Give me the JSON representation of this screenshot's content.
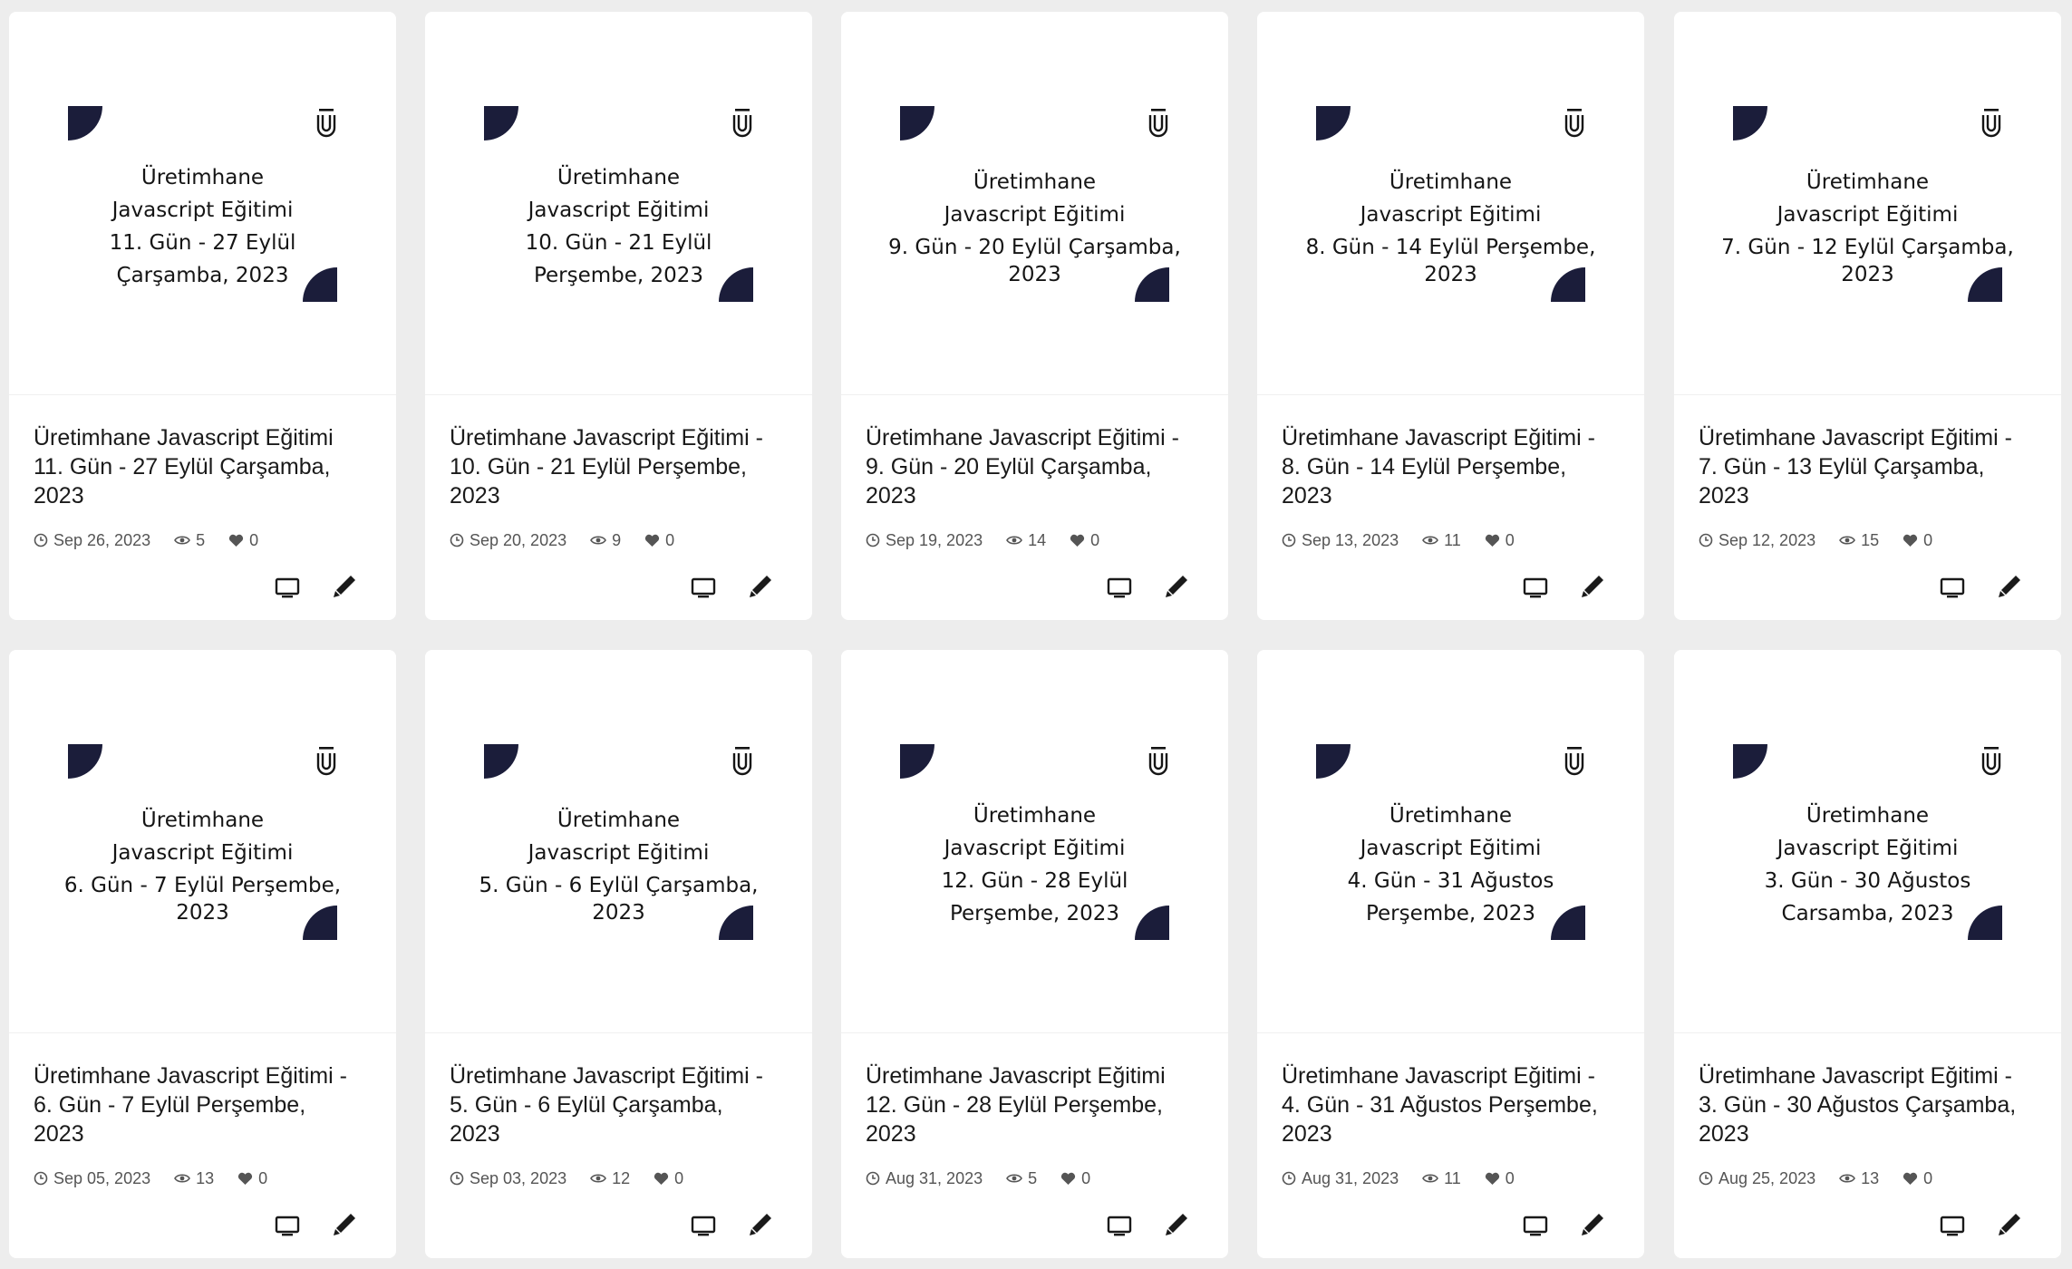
{
  "cards": [
    {
      "thumb_l1": "Üretimhane",
      "thumb_l2": "Javascript Eğitimi",
      "thumb_l3": "11. Gün - 27 Eylül",
      "thumb_l4": "Çarşamba, 2023",
      "title": "Üretimhane Javascript Eğitimi\n11. Gün - 27 Eylül Çarşamba,\n2023",
      "date": "Sep 26, 2023",
      "views": "5",
      "likes": "0"
    },
    {
      "thumb_l1": "Üretimhane",
      "thumb_l2": "Javascript Eğitimi",
      "thumb_l3": "10. Gün - 21 Eylül",
      "thumb_l4": "Perşembe, 2023",
      "title": "Üretimhane Javascript Eğitimi -\n10. Gün - 21 Eylül Perşembe,\n2023",
      "date": "Sep 20, 2023",
      "views": "9",
      "likes": "0"
    },
    {
      "thumb_l1": "Üretimhane",
      "thumb_l2": "Javascript Eğitimi",
      "thumb_l3": "9. Gün - 20 Eylül Çarşamba,",
      "thumb_l4": "2023",
      "title": "Üretimhane Javascript Eğitimi -\n9. Gün - 20 Eylül Çarşamba,\n2023",
      "date": "Sep 19, 2023",
      "views": "14",
      "likes": "0"
    },
    {
      "thumb_l1": "Üretimhane",
      "thumb_l2": "Javascript Eğitimi",
      "thumb_l3": "8. Gün - 14 Eylül Perşembe,",
      "thumb_l4": "2023",
      "title": "Üretimhane Javascript Eğitimi -\n8. Gün - 14 Eylül Perşembe,\n2023",
      "date": "Sep 13, 2023",
      "views": "11",
      "likes": "0"
    },
    {
      "thumb_l1": "Üretimhane",
      "thumb_l2": "Javascript Eğitimi",
      "thumb_l3": "7. Gün - 12 Eylül Çarşamba,",
      "thumb_l4": "2023",
      "title": "Üretimhane Javascript Eğitimi -\n7. Gün - 13 Eylül Çarşamba,\n2023",
      "date": "Sep 12, 2023",
      "views": "15",
      "likes": "0"
    },
    {
      "thumb_l1": "Üretimhane",
      "thumb_l2": "Javascript Eğitimi",
      "thumb_l3": "6. Gün - 7 Eylül Perşembe,",
      "thumb_l4": "2023",
      "title": "Üretimhane Javascript Eğitimi -\n6. Gün - 7 Eylül Perşembe,\n2023",
      "date": "Sep 05, 2023",
      "views": "13",
      "likes": "0"
    },
    {
      "thumb_l1": "Üretimhane",
      "thumb_l2": "Javascript Eğitimi",
      "thumb_l3": "5. Gün - 6 Eylül Çarşamba,",
      "thumb_l4": "2023",
      "title": "Üretimhane Javascript Eğitimi -\n5. Gün - 6 Eylül Çarşamba,\n2023",
      "date": "Sep 03, 2023",
      "views": "12",
      "likes": "0"
    },
    {
      "thumb_l1": "Üretimhane",
      "thumb_l2": "Javascript Eğitimi",
      "thumb_l3": "12. Gün - 28 Eylül",
      "thumb_l4": "Perşembe, 2023",
      "title": "Üretimhane Javascript Eğitimi\n12. Gün - 28 Eylül Perşembe,\n2023",
      "date": "Aug 31, 2023",
      "views": "5",
      "likes": "0"
    },
    {
      "thumb_l1": "Üretimhane",
      "thumb_l2": "Javascript Eğitimi",
      "thumb_l3": "4. Gün - 31 Ağustos",
      "thumb_l4": "Perşembe, 2023",
      "title": "Üretimhane Javascript Eğitimi -\n4. Gün - 31 Ağustos Perşembe,\n2023",
      "date": "Aug 31, 2023",
      "views": "11",
      "likes": "0"
    },
    {
      "thumb_l1": "Üretimhane",
      "thumb_l2": "Javascript Eğitimi",
      "thumb_l3": "3. Gün - 30 Ağustos",
      "thumb_l4": "Carsamba, 2023",
      "title": "Üretimhane Javascript Eğitimi -\n3. Gün - 30 Ağustos Çarşamba,\n2023",
      "date": "Aug 25, 2023",
      "views": "13",
      "likes": "0"
    }
  ],
  "icons": {
    "date": "clock-icon",
    "views": "eye-icon",
    "likes": "heart-icon",
    "present": "monitor-icon",
    "edit": "pen-icon",
    "logo": "u-logo-icon"
  },
  "colors": {
    "page_bg": "#ededed",
    "card_bg": "#ffffff",
    "accent_navy": "#1b1d3a",
    "text": "#1a1a1a",
    "meta_text": "#555555"
  }
}
